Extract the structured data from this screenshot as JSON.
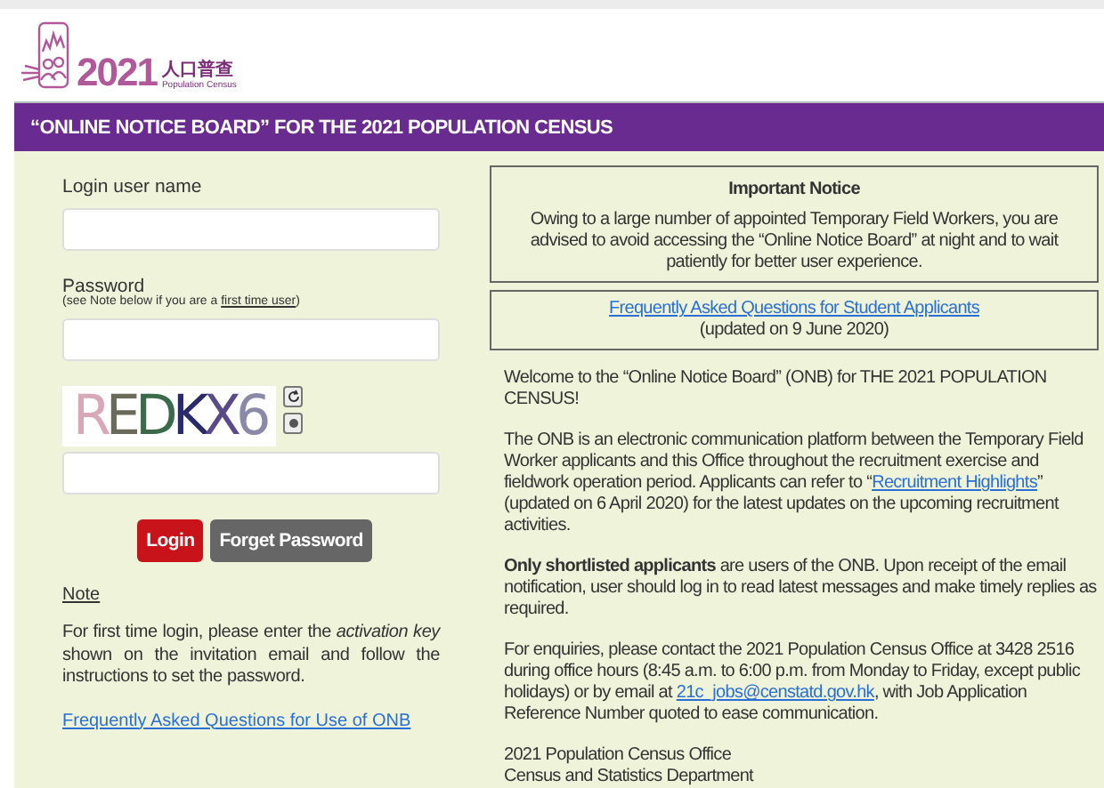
{
  "logo": {
    "year": "2021",
    "chinese": "人口普查",
    "english": "Population Census"
  },
  "banner": {
    "title": "“ONLINE NOTICE BOARD” FOR THE 2021 POPULATION CENSUS"
  },
  "login": {
    "username_label": "Login user name",
    "password_label": "Password",
    "password_hint": [
      {
        "kind": "text",
        "text": "(see Note below if you are a "
      },
      {
        "kind": "link",
        "text": "first time user"
      },
      {
        "kind": "text",
        "text": ")"
      }
    ],
    "captcha": "REDKX6",
    "buttons": [
      {
        "label": "Login",
        "kind": "primary"
      },
      {
        "label": "Forget Password",
        "kind": "secondary"
      }
    ],
    "note_title": "Note",
    "note_text": "For first time login, please enter the *activation key* shown on the invitation email and follow the instructions to set the password.",
    "faq_link": "Frequently Asked Questions for Use of ONB"
  },
  "important_notice": {
    "title": "Important Notice",
    "text": "Owing to a large number of appointed Temporary Field Workers, you are advised to avoid accessing the “Online Notice Board” at night and to wait patiently for better user experience."
  },
  "faq_box": {
    "link": "Frequently Asked Questions for Student Applicants",
    "updated": "(updated on 9 June 2020)"
  },
  "paragraphs": [
    {
      "parts": [
        {
          "kind": "text",
          "text": "Welcome to the “Online Notice Board” (ONB) for THE 2021 POPULATION CENSUS!"
        }
      ]
    },
    {
      "parts": [
        {
          "kind": "text",
          "text": "The ONB is an electronic communication platform between the Temporary Field Worker applicants and this Office throughout the recruitment exercise and fieldwork operation period. Applicants can refer to “"
        },
        {
          "kind": "link",
          "text": "Recruitment Highlights"
        },
        {
          "kind": "text",
          "text": "” (updated on 6 April 2020) for the latest updates on the upcoming recruitment activities."
        }
      ]
    },
    {
      "parts": [
        {
          "kind": "text",
          "text": "**Only shortlisted applicants** are users of the ONB. Upon receipt of the email notification, user should log in to read latest messages and make timely replies as required."
        }
      ]
    },
    {
      "parts": [
        {
          "kind": "text",
          "text": "For enquiries, please contact the 2021 Population Census Office at 3428 2516 during office hours (8:45 a.m. to 6:00 p.m. from Monday to Friday, except public holidays) or by email at "
        },
        {
          "kind": "link",
          "text": "21c_jobs@censtatd.gov.hk"
        },
        {
          "kind": "text",
          "text": ", with Job Application Reference Number quoted to ease communication."
        }
      ]
    }
  ],
  "signature": [
    "2021 Population Census Office",
    "Census and Statistics Department"
  ]
}
